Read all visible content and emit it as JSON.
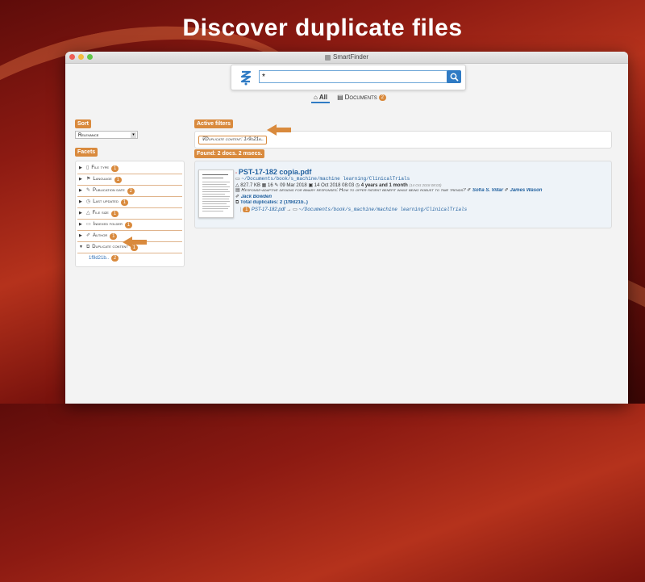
{
  "headline": "Discover duplicate files",
  "window": {
    "title": "SmartFinder"
  },
  "search": {
    "value": "*",
    "placeholder": ""
  },
  "tabs": [
    {
      "label": "All",
      "active": true
    },
    {
      "label": "Documents",
      "count": "2"
    }
  ],
  "sort": {
    "label": "Sort",
    "selected": "Relevance"
  },
  "facets": {
    "label": "Facets",
    "items": [
      {
        "label": "File type",
        "count": "1"
      },
      {
        "label": "Language",
        "count": "1"
      },
      {
        "label": "Publication date",
        "count": "2"
      },
      {
        "label": "Last updated",
        "count": "1"
      },
      {
        "label": "File size",
        "count": "1"
      },
      {
        "label": "Indexed folder",
        "count": "1"
      },
      {
        "label": "Author",
        "count": "1"
      },
      {
        "label": "Duplicate content",
        "count": "1"
      }
    ],
    "expanded_value": {
      "label": "1f9d21b..",
      "count": "2"
    }
  },
  "active_filters": {
    "label": "Active filters",
    "chip": "Duplicate content: 1f9d21b.."
  },
  "results": {
    "header": "Found: 2 docs. 2 msecs.",
    "item": {
      "title": "PST-17-182 copia.pdf",
      "path": "~/Documents/book/s_machine/machine learning/ClinicalTrials",
      "size": "827.7 KB",
      "pages": "16",
      "published": "09 Mar 2018",
      "modified": "14 Oct 2018 08:03",
      "age": "4 years and 1 month",
      "age_detail": "(14 Oct 2018 08:03)",
      "subject": "Response-adaptive designs for binary responses: How to offer patient benefit while being robust to time trends?",
      "authors": [
        "Sofia S. Villar",
        "James Wason",
        "Jack Bowden"
      ],
      "duplicates_label": "Total duplicates: 2 (1f9d21b..)",
      "dup_num": "1",
      "dup_file": "PST-17-182.pdf",
      "dup_path": "~/Documents/book/s_machine/machine learning/ClinicalTrials"
    }
  },
  "colors": {
    "accent": "#d98a3d",
    "link": "#1f5f9e",
    "search_button": "#2f7bc4"
  }
}
